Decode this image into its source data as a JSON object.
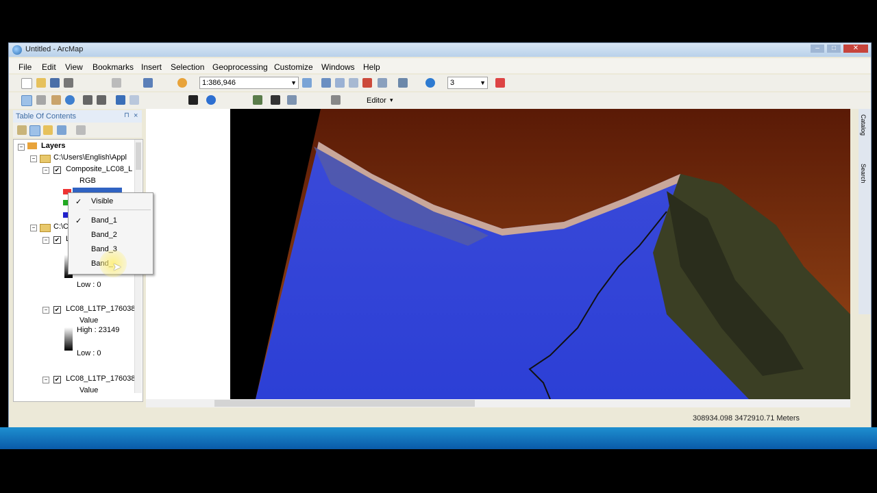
{
  "window": {
    "title": "Untitled - ArcMap"
  },
  "menu": [
    "File",
    "Edit",
    "View",
    "Bookmarks",
    "Insert",
    "Selection",
    "Geoprocessing",
    "Customize",
    "Windows",
    "Help"
  ],
  "toolbar": {
    "scale": "1:386,946",
    "editor_label": "Editor",
    "layer_value": "3"
  },
  "toc": {
    "title": "Table Of Contents",
    "layers_label": "Layers",
    "group1_path": "C:\\Users\\English\\Appl",
    "composite_layer": "Composite_LC08_L",
    "rgb_label": "RGB",
    "group2_path": "C:\\C",
    "layer2_letter": "L",
    "layer2_low": "Low : 0",
    "layer3_name": "LC08_L1TP_176038",
    "layer3_value": "Value",
    "layer3_high": "High : 23149",
    "layer3_low": "Low : 0",
    "layer4_name": "LC08_L1TP_176038",
    "layer4_value": "Value"
  },
  "context_menu": {
    "items": [
      {
        "label": "Visible",
        "checked": true
      },
      {
        "label": "Band_1",
        "checked": true
      },
      {
        "label": "Band_2",
        "checked": false
      },
      {
        "label": "Band_3",
        "checked": false
      },
      {
        "label": "Band_",
        "checked": false
      }
    ]
  },
  "status": {
    "coords": "308934.098  3472910.71 Meters"
  },
  "side_tabs": [
    "Catalog",
    "Search"
  ]
}
